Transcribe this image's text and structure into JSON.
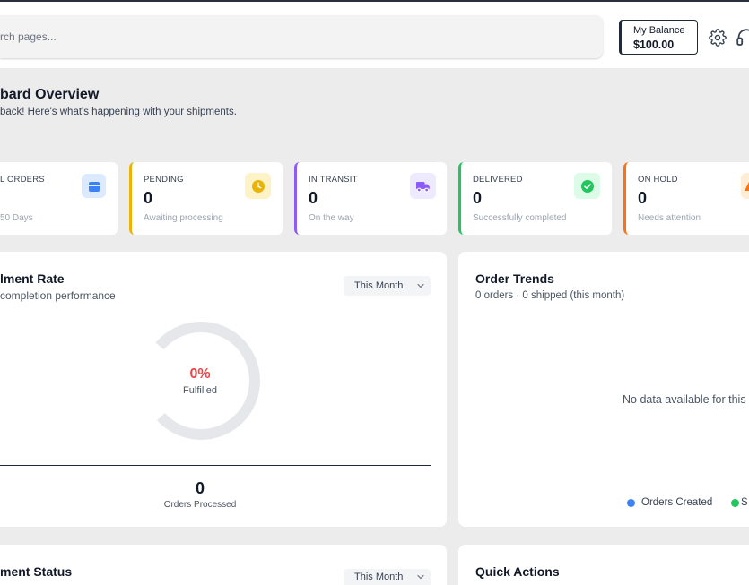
{
  "header": {
    "search": {
      "placeholder": "rch pages..."
    },
    "balance": {
      "label": "My Balance",
      "amount": "$100.00"
    },
    "icons": [
      "gear-icon",
      "headset-icon"
    ]
  },
  "page": {
    "title": "bard Overview",
    "subtitle": "back! Here's what's happening with your shipments."
  },
  "stats": [
    {
      "label": "L ORDERS",
      "caption": "50 Days",
      "icon": "box-icon",
      "accent": "#3b82f6",
      "tint": "#dbeafe"
    },
    {
      "label": "PENDING",
      "value": "0",
      "caption": "Awaiting processing",
      "icon": "clock-icon",
      "accent": "#eab308",
      "tint": "#fef3c7"
    },
    {
      "label": "IN TRANSIT",
      "value": "0",
      "caption": "On the way",
      "icon": "truck-icon",
      "accent": "#8b5cf6",
      "tint": "#ede9fe"
    },
    {
      "label": "DELIVERED",
      "value": "0",
      "caption": "Successfully completed",
      "icon": "check-circle-icon",
      "accent": "#22c55e",
      "tint": "#dcfce7"
    },
    {
      "label": "ON HOLD",
      "value": "0",
      "caption": "Needs attention",
      "icon": "alert-icon",
      "accent": "#f97316",
      "tint": "#ffedd5"
    }
  ],
  "fulfillment": {
    "title": "lment Rate",
    "subtitle": "completion performance",
    "period": "This Month",
    "percent": 0,
    "percent_label": "0%",
    "color": "#ef4444",
    "status": "Fulfilled",
    "processed_value": "0",
    "processed_label": "Orders Processed"
  },
  "trends": {
    "title": "Order Trends",
    "subtitle": "0 orders · 0 shipped (this month)",
    "empty_text": "No data available for this",
    "legend": [
      {
        "label": "Orders Created",
        "color": "#3b82f6"
      },
      {
        "label": "S",
        "color": "#22c55e"
      }
    ]
  },
  "shipment_status": {
    "title": "ment Status",
    "period": "This Month"
  },
  "quick_actions": {
    "title": "Quick Actions"
  }
}
